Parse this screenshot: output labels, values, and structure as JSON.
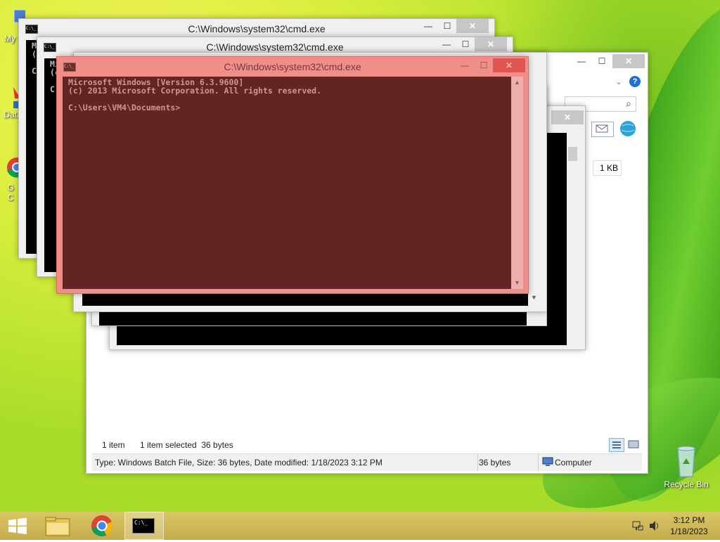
{
  "desktop": {
    "icons": [
      {
        "name": "my-computer",
        "label": "My C"
      },
      {
        "name": "data",
        "label": "Data"
      },
      {
        "name": "chrome",
        "label": "G"
      },
      {
        "name": "recycle-bin",
        "label": "Recycle Bin"
      }
    ],
    "chrome_label_line2": "C"
  },
  "cmd_windows": {
    "title": "C:\\Windows\\system32\\cmd.exe",
    "icon_text": "C:\\_",
    "minimize_glyph": "—",
    "maximize_glyph": "☐",
    "close_glyph": "✕"
  },
  "cmd_front": {
    "lines": [
      "Microsoft Windows [Version 6.3.9600]",
      "(c) 2013 Microsoft Corporation. All rights reserved.",
      "",
      "C:\\Users\\VM4\\Documents>"
    ]
  },
  "cmd_back1": {
    "lines": [
      "Mi",
      "(c",
      "",
      "C:"
    ]
  },
  "cmd_back2": {
    "lines": [
      "Mi",
      "(c",
      "",
      "C:"
    ]
  },
  "explorer": {
    "size_cell": "1 KB",
    "status_items": "1 item",
    "status_selected": "1 item selected  36 bytes",
    "status_type": "Type: Windows Batch File, Size: 36 bytes, Date modified: 1/18/2023 3:12 PM",
    "status_size": "36 bytes",
    "status_location": "Computer",
    "help_glyph": "?",
    "search_glyph": "⌕",
    "chevron_glyph": "⌄"
  },
  "taskbar": {
    "time": "3:12 PM",
    "date": "1/18/2023",
    "cmd_icon_text": "C:\\_"
  },
  "colors": {
    "highlight_red": "#e8706b",
    "taskbar": "#cfb85a",
    "cmd_bg": "#000000"
  }
}
